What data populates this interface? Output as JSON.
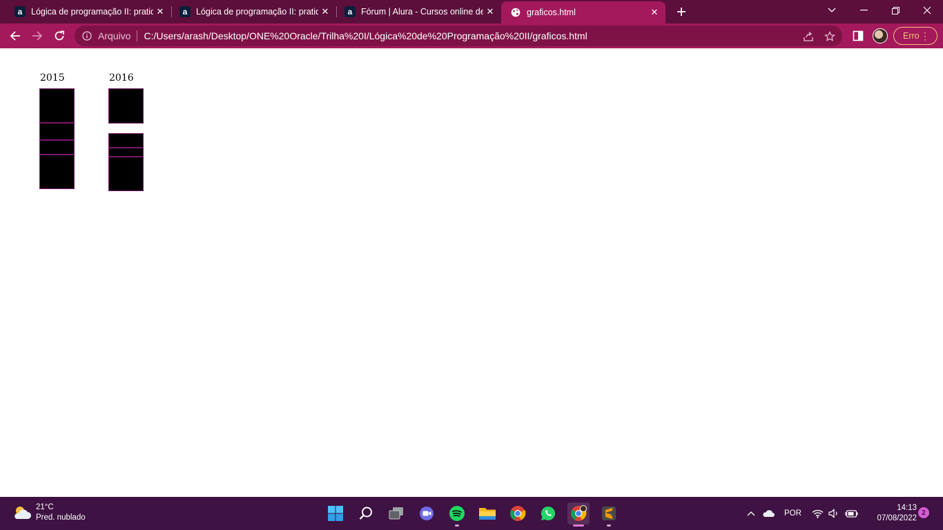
{
  "browser": {
    "tabs": [
      {
        "title": "Lógica de programação II: pratique",
        "favicon": "alura-icon",
        "active": false
      },
      {
        "title": "Lógica de programação II: pratique",
        "favicon": "alura-icon",
        "active": false
      },
      {
        "title": "Fórum | Alura - Cursos online de",
        "favicon": "alura-icon",
        "active": false
      },
      {
        "title": "graficos.html",
        "favicon": "globe-icon",
        "active": true
      }
    ],
    "omnibox": {
      "chip": "Arquivo",
      "url": "C:/Users/arash/Desktop/ONE%20Oracle/Trilha%20I/Lógica%20de%20Programação%20II/graficos.html"
    },
    "profile_error_label": "Erro",
    "colors": {
      "tabstrip": "#5c0f3b",
      "toolbar": "#a3195b",
      "accent_error": "#f3c07a"
    }
  },
  "page": {
    "years": [
      "2015",
      "2016"
    ]
  },
  "taskbar": {
    "weather": {
      "temp": "21°C",
      "desc": "Pred. nublado"
    },
    "language": "POR",
    "time": "14:13",
    "date": "07/08/2022",
    "notifications": "2",
    "apps": [
      "windows-start-icon",
      "search-icon",
      "task-view-icon",
      "teams-chat-icon",
      "spotify-icon",
      "file-explorer-icon",
      "chrome-icon",
      "whatsapp-icon",
      "chrome-profile-icon",
      "sublime-text-icon"
    ]
  }
}
